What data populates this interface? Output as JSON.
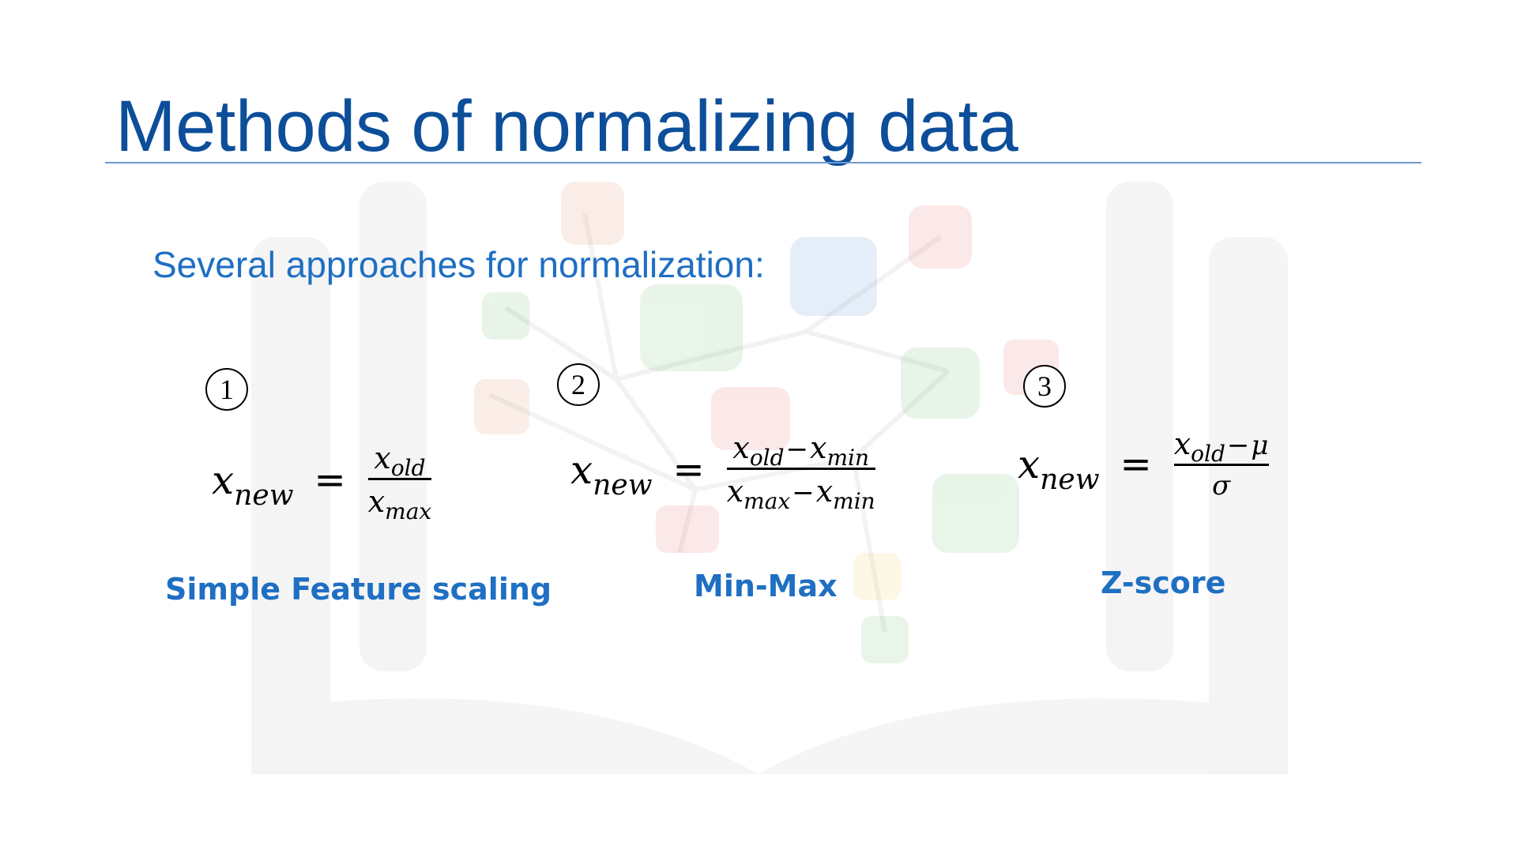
{
  "slide": {
    "title": "Methods of normalizing data",
    "subtitle": "Several approaches for normalization:"
  },
  "methods": [
    {
      "number": "1",
      "label": "Simple Feature scaling",
      "lhs": {
        "var": "x",
        "sub": "new"
      },
      "equals": "=",
      "numerator": {
        "var": "x",
        "sub": "old"
      },
      "denominator": {
        "var": "x",
        "sub": "max"
      }
    },
    {
      "number": "2",
      "label": "Min-Max",
      "lhs": {
        "var": "x",
        "sub": "new"
      },
      "equals": "=",
      "numerator": {
        "a_var": "x",
        "a_sub": "old",
        "op": "−",
        "b_var": "x",
        "b_sub": "min"
      },
      "denominator": {
        "a_var": "x",
        "a_sub": "max",
        "op": "−",
        "b_var": "x",
        "b_sub": "min"
      }
    },
    {
      "number": "3",
      "label": "Z-score",
      "lhs": {
        "var": "x",
        "sub": "new"
      },
      "equals": "=",
      "numerator": {
        "a_var": "x",
        "a_sub": "old",
        "op": "−",
        "b_sym": "μ"
      },
      "denominator": {
        "sym": "σ"
      }
    }
  ],
  "colors": {
    "title": "#0d4e9a",
    "title_rule": "#6f9ad1",
    "accent_text": "#1f6fc3",
    "formula_text": "#000000",
    "background": "#ffffff"
  },
  "icons": {
    "background_watermark": "open-book-network-watermark"
  }
}
